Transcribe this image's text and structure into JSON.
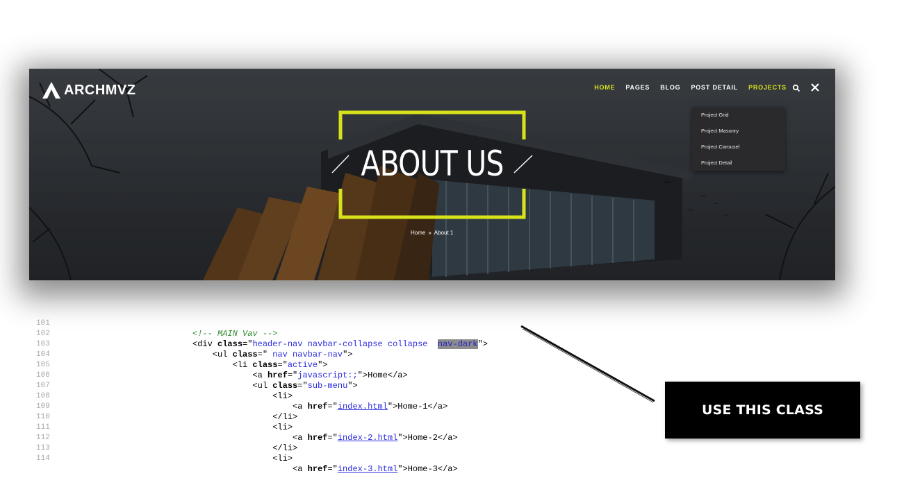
{
  "hero": {
    "logo_text": "ARCHMVZ",
    "nav": [
      {
        "label": "HOME",
        "active": true
      },
      {
        "label": "PAGES",
        "active": false
      },
      {
        "label": "BLOG",
        "active": false
      },
      {
        "label": "POST DETAIL",
        "active": false
      },
      {
        "label": "PROJECTS",
        "active": true
      }
    ],
    "dropdown": [
      "Project Grid",
      "Project Masonry",
      "Project Carousel",
      "Project Detail"
    ],
    "title": "ABOUT US",
    "breadcrumb": {
      "home": "Home",
      "separator": "»",
      "current": "About 1"
    },
    "accent_color": "#d8e21a",
    "icons": [
      "search-icon",
      "close-icon",
      "logo-mark-icon"
    ]
  },
  "code": {
    "lines": [
      {
        "n": "101",
        "c": 1
      },
      {
        "n": "102",
        "c": 2
      },
      {
        "n": "103",
        "c": 3
      },
      {
        "n": "104",
        "c": 4
      },
      {
        "n": "105",
        "c": 5
      },
      {
        "n": "106",
        "c": 6
      },
      {
        "n": "107",
        "c": 7
      },
      {
        "n": "108",
        "c": 8
      },
      {
        "n": "109",
        "c": 9
      },
      {
        "n": "110",
        "c": 10
      },
      {
        "n": "111",
        "c": 11
      },
      {
        "n": "112",
        "c": 12
      },
      {
        "n": "113",
        "c": 13
      },
      {
        "n": "114",
        "c": 14
      }
    ],
    "comment": "<!-- MAIN Vav -->",
    "div_class": "header-nav navbar-collapse collapse ",
    "highlight": "nav-dark",
    "ul_class": " nav navbar-nav",
    "li_class": "active",
    "a_href": "javascript:;",
    "a_text": "Home",
    "sub_class": "sub-menu",
    "links": [
      {
        "href": "index.html",
        "text": "Home-1"
      },
      {
        "href": "index-2.html",
        "text": "Home-2"
      },
      {
        "href": "index-3.html",
        "text": "Home-3"
      }
    ]
  },
  "callout": {
    "text": "USE THIS CLASS"
  }
}
